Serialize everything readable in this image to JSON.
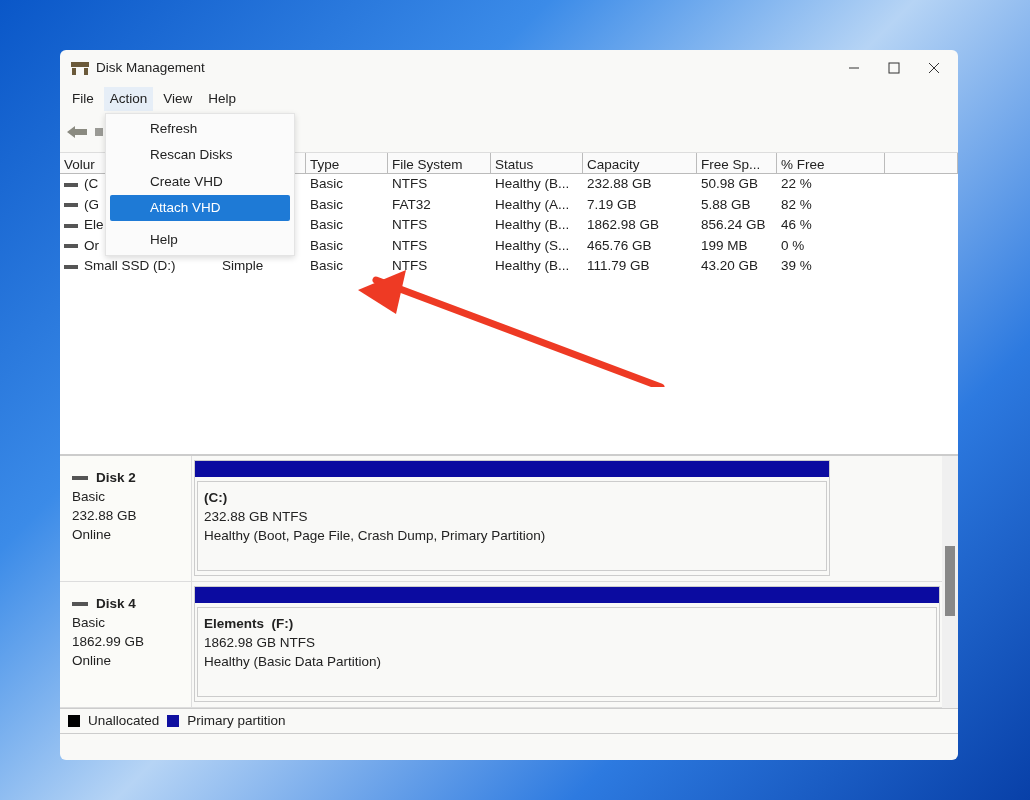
{
  "window": {
    "title": "Disk Management"
  },
  "menu_bar": [
    {
      "label": "File",
      "selected": false
    },
    {
      "label": "Action",
      "selected": true
    },
    {
      "label": "View",
      "selected": false
    },
    {
      "label": "Help",
      "selected": false
    }
  ],
  "action_menu": [
    {
      "kind": "item",
      "label": "Refresh",
      "selected": false
    },
    {
      "kind": "item",
      "label": "Rescan Disks",
      "selected": false
    },
    {
      "kind": "item",
      "label": "Create VHD",
      "selected": false
    },
    {
      "kind": "item",
      "label": "Attach VHD",
      "selected": true
    },
    {
      "kind": "separator"
    },
    {
      "kind": "item",
      "label": "Help",
      "selected": false
    }
  ],
  "volume_table": {
    "columns": [
      "Volur",
      "",
      "Type",
      "File System",
      "Status",
      "Capacity",
      "Free Sp...",
      "% Free"
    ],
    "rows": [
      [
        "(C",
        "",
        "Basic",
        "NTFS",
        "Healthy (B...",
        "232.88 GB",
        "50.98 GB",
        "22 %"
      ],
      [
        "(G",
        "",
        "Basic",
        "FAT32",
        "Healthy (A...",
        "7.19 GB",
        "5.88 GB",
        "82 %"
      ],
      [
        "Ele",
        "",
        "Basic",
        "NTFS",
        "Healthy (B...",
        "1862.98 GB",
        "856.24 GB",
        "46 %"
      ],
      [
        "Or",
        "",
        "Basic",
        "NTFS",
        "Healthy (S...",
        "465.76 GB",
        "199 MB",
        "0 %"
      ],
      [
        "Small SSD (D:)",
        "Simple",
        "Basic",
        "NTFS",
        "Healthy (B...",
        "111.79 GB",
        "43.20 GB",
        "39 %"
      ]
    ]
  },
  "disks": [
    {
      "name": "Disk 2",
      "type": "Basic",
      "size": "232.88 GB",
      "state": "Online",
      "partition": {
        "label": "(C:)",
        "size": "232.88 GB NTFS",
        "status": "Healthy (Boot, Page File, Crash Dump, Primary Partition)",
        "full_width": false
      }
    },
    {
      "name": "Disk 4",
      "type": "Basic",
      "size": "1862.99 GB",
      "state": "Online",
      "partition": {
        "label": "Elements  (F:)",
        "size": "1862.98 GB NTFS",
        "status": "Healthy (Basic Data Partition)",
        "full_width": true
      }
    }
  ],
  "legend": [
    {
      "label": "Unallocated",
      "color": "#000000"
    },
    {
      "label": "Primary partition",
      "color": "#1010a0"
    }
  ]
}
